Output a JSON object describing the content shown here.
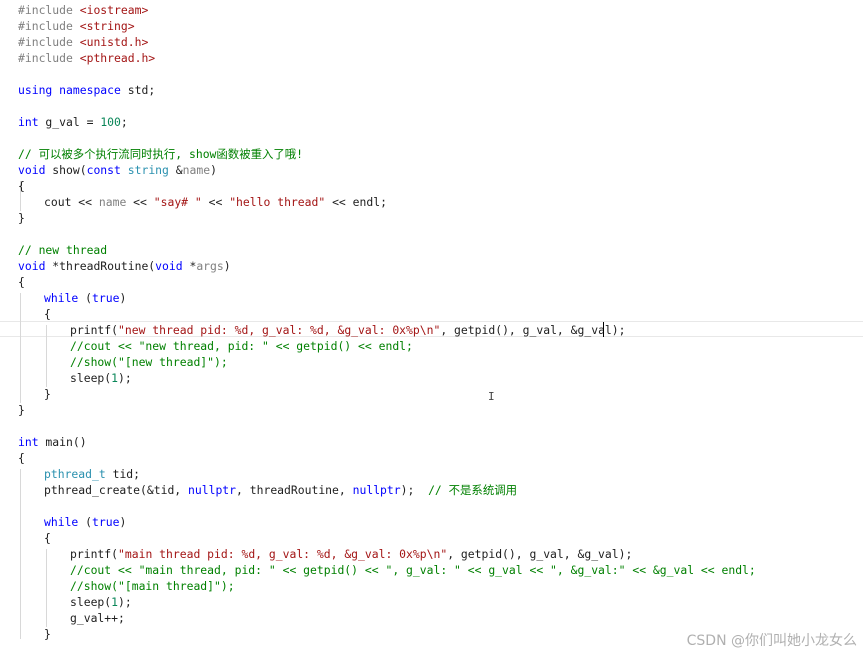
{
  "colors": {
    "keyword": "#0000ff",
    "type": "#2b91af",
    "string": "#a31515",
    "comment": "#008000",
    "preprocessor": "#808080",
    "include_file": "#a31515",
    "number": "#098658",
    "parameter": "#808080",
    "default": "#1e1e1e",
    "watermark": "#b0b0b0"
  },
  "code_lines": [
    {
      "row": 0,
      "indent": 0,
      "tokens": [
        {
          "t": "#include ",
          "c": "preprocessor"
        },
        {
          "t": "<iostream>",
          "c": "include_file"
        }
      ]
    },
    {
      "row": 1,
      "indent": 0,
      "tokens": [
        {
          "t": "#include ",
          "c": "preprocessor"
        },
        {
          "t": "<string>",
          "c": "include_file"
        }
      ]
    },
    {
      "row": 2,
      "indent": 0,
      "tokens": [
        {
          "t": "#include ",
          "c": "preprocessor"
        },
        {
          "t": "<unistd.h>",
          "c": "include_file"
        }
      ]
    },
    {
      "row": 3,
      "indent": 0,
      "tokens": [
        {
          "t": "#include ",
          "c": "preprocessor"
        },
        {
          "t": "<pthread.h>",
          "c": "include_file"
        }
      ]
    },
    {
      "row": 5,
      "indent": 0,
      "tokens": [
        {
          "t": "using",
          "c": "keyword"
        },
        {
          "t": " ",
          "c": "default"
        },
        {
          "t": "namespace",
          "c": "keyword"
        },
        {
          "t": " std;",
          "c": "default"
        }
      ]
    },
    {
      "row": 7,
      "indent": 0,
      "tokens": [
        {
          "t": "int",
          "c": "keyword"
        },
        {
          "t": " g_val = ",
          "c": "default"
        },
        {
          "t": "100",
          "c": "number"
        },
        {
          "t": ";",
          "c": "default"
        }
      ]
    },
    {
      "row": 9,
      "indent": 0,
      "tokens": [
        {
          "t": "// 可以被多个执行流同时执行, show函数被重入了哦!",
          "c": "comment"
        }
      ]
    },
    {
      "row": 10,
      "indent": 0,
      "tokens": [
        {
          "t": "void",
          "c": "keyword"
        },
        {
          "t": " show(",
          "c": "default"
        },
        {
          "t": "const",
          "c": "keyword"
        },
        {
          "t": " ",
          "c": "default"
        },
        {
          "t": "string",
          "c": "type"
        },
        {
          "t": " &",
          "c": "default"
        },
        {
          "t": "name",
          "c": "parameter"
        },
        {
          "t": ")",
          "c": "default"
        }
      ]
    },
    {
      "row": 11,
      "indent": 0,
      "tokens": [
        {
          "t": "{",
          "c": "default"
        }
      ]
    },
    {
      "row": 12,
      "indent": 1,
      "tokens": [
        {
          "t": "cout << ",
          "c": "default"
        },
        {
          "t": "name",
          "c": "parameter"
        },
        {
          "t": " << ",
          "c": "default"
        },
        {
          "t": "\"say# \"",
          "c": "string"
        },
        {
          "t": " << ",
          "c": "default"
        },
        {
          "t": "\"hello thread\"",
          "c": "string"
        },
        {
          "t": " << endl;",
          "c": "default"
        }
      ]
    },
    {
      "row": 13,
      "indent": 0,
      "tokens": [
        {
          "t": "}",
          "c": "default"
        }
      ]
    },
    {
      "row": 15,
      "indent": 0,
      "tokens": [
        {
          "t": "// new thread",
          "c": "comment"
        }
      ]
    },
    {
      "row": 16,
      "indent": 0,
      "tokens": [
        {
          "t": "void",
          "c": "keyword"
        },
        {
          "t": " *threadRoutine(",
          "c": "default"
        },
        {
          "t": "void",
          "c": "keyword"
        },
        {
          "t": " *",
          "c": "default"
        },
        {
          "t": "args",
          "c": "parameter"
        },
        {
          "t": ")",
          "c": "default"
        }
      ]
    },
    {
      "row": 17,
      "indent": 0,
      "tokens": [
        {
          "t": "{",
          "c": "default"
        }
      ]
    },
    {
      "row": 18,
      "indent": 1,
      "tokens": [
        {
          "t": "while",
          "c": "keyword"
        },
        {
          "t": " (",
          "c": "default"
        },
        {
          "t": "true",
          "c": "keyword"
        },
        {
          "t": ")",
          "c": "default"
        }
      ]
    },
    {
      "row": 19,
      "indent": 1,
      "tokens": [
        {
          "t": "{",
          "c": "default"
        }
      ]
    },
    {
      "row": 20,
      "indent": 2,
      "tokens": [
        {
          "t": "printf(",
          "c": "default"
        },
        {
          "t": "\"new thread pid: %d, g_val: %d, &g_val: 0x%p\\n\"",
          "c": "string"
        },
        {
          "t": ", getpid(), g_val, &g_val);",
          "c": "default"
        }
      ]
    },
    {
      "row": 21,
      "indent": 2,
      "tokens": [
        {
          "t": "//cout << \"new thread, pid: \" << getpid() << endl;",
          "c": "comment"
        }
      ]
    },
    {
      "row": 22,
      "indent": 2,
      "tokens": [
        {
          "t": "//show(\"[new thread]\");",
          "c": "comment"
        }
      ]
    },
    {
      "row": 23,
      "indent": 2,
      "tokens": [
        {
          "t": "sleep(",
          "c": "default"
        },
        {
          "t": "1",
          "c": "number"
        },
        {
          "t": ");",
          "c": "default"
        }
      ]
    },
    {
      "row": 24,
      "indent": 1,
      "tokens": [
        {
          "t": "}",
          "c": "default"
        }
      ]
    },
    {
      "row": 25,
      "indent": 0,
      "tokens": [
        {
          "t": "}",
          "c": "default"
        }
      ]
    },
    {
      "row": 27,
      "indent": 0,
      "tokens": [
        {
          "t": "int",
          "c": "keyword"
        },
        {
          "t": " main()",
          "c": "default"
        }
      ]
    },
    {
      "row": 28,
      "indent": 0,
      "tokens": [
        {
          "t": "{",
          "c": "default"
        }
      ]
    },
    {
      "row": 29,
      "indent": 1,
      "tokens": [
        {
          "t": "pthread_t",
          "c": "type"
        },
        {
          "t": " tid;",
          "c": "default"
        }
      ]
    },
    {
      "row": 30,
      "indent": 1,
      "tokens": [
        {
          "t": "pthread_create(&tid, ",
          "c": "default"
        },
        {
          "t": "nullptr",
          "c": "keyword"
        },
        {
          "t": ", threadRoutine, ",
          "c": "default"
        },
        {
          "t": "nullptr",
          "c": "keyword"
        },
        {
          "t": ");  ",
          "c": "default"
        },
        {
          "t": "// 不是系统调用",
          "c": "comment"
        }
      ]
    },
    {
      "row": 32,
      "indent": 1,
      "tokens": [
        {
          "t": "while",
          "c": "keyword"
        },
        {
          "t": " (",
          "c": "default"
        },
        {
          "t": "true",
          "c": "keyword"
        },
        {
          "t": ")",
          "c": "default"
        }
      ]
    },
    {
      "row": 33,
      "indent": 1,
      "tokens": [
        {
          "t": "{",
          "c": "default"
        }
      ]
    },
    {
      "row": 34,
      "indent": 2,
      "tokens": [
        {
          "t": "printf(",
          "c": "default"
        },
        {
          "t": "\"main thread pid: %d, g_val: %d, &g_val: 0x%p\\n\"",
          "c": "string"
        },
        {
          "t": ", getpid(), g_val, &g_val);",
          "c": "default"
        }
      ]
    },
    {
      "row": 35,
      "indent": 2,
      "tokens": [
        {
          "t": "//cout << \"main thread, pid: \" << getpid() << \", g_val: \" << g_val << \", &g_val:\" << &g_val << endl;",
          "c": "comment"
        }
      ]
    },
    {
      "row": 36,
      "indent": 2,
      "tokens": [
        {
          "t": "//show(\"[main thread]\");",
          "c": "comment"
        }
      ]
    },
    {
      "row": 37,
      "indent": 2,
      "tokens": [
        {
          "t": "sleep(",
          "c": "default"
        },
        {
          "t": "1",
          "c": "number"
        },
        {
          "t": ");",
          "c": "default"
        }
      ]
    },
    {
      "row": 38,
      "indent": 2,
      "tokens": [
        {
          "t": "g_val++;",
          "c": "default"
        }
      ]
    },
    {
      "row": 39,
      "indent": 1,
      "tokens": [
        {
          "t": "}",
          "c": "default"
        }
      ]
    }
  ],
  "watermark": "CSDN @你们叫她小龙女么"
}
